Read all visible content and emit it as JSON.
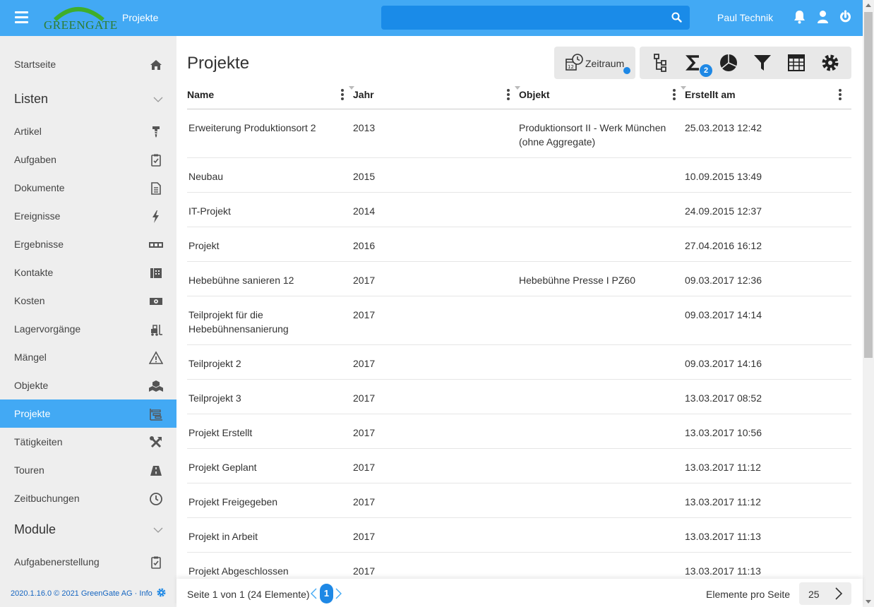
{
  "header": {
    "logo_text": "GREENGATE",
    "app_title": "Projekte",
    "search_placeholder": "",
    "user_name": "Paul Technik"
  },
  "sidebar": {
    "home": "Startseite",
    "group_listen": "Listen",
    "items": [
      "Artikel",
      "Aufgaben",
      "Dokumente",
      "Ereignisse",
      "Ergebnisse",
      "Kontakte",
      "Kosten",
      "Lagervorgänge",
      "Mängel",
      "Objekte",
      "Projekte",
      "Tätigkeiten",
      "Touren",
      "Zeitbuchungen"
    ],
    "group_module": "Module",
    "module_items": [
      "Aufgabenerstellung"
    ],
    "footer_text": "2020.1.16.0 © 2021 GreenGate AG · Info"
  },
  "main": {
    "title": "Projekte",
    "zeitraum_label": "Zeitraum",
    "sum_badge": "2",
    "columns": [
      "Name",
      "Jahr",
      "Objekt",
      "Erstellt am"
    ],
    "rows": [
      [
        "Erweiterung Produktionsort 2",
        "2013",
        "Produktionsort II - Werk München (ohne Aggregate)",
        "25.03.2013 12:42"
      ],
      [
        "Neubau",
        "2015",
        "",
        "10.09.2015 13:49"
      ],
      [
        "IT-Projekt",
        "2014",
        "",
        "24.09.2015 12:37"
      ],
      [
        "Projekt",
        "2016",
        "",
        "27.04.2016 16:12"
      ],
      [
        "Hebebühne sanieren 12",
        "2017",
        "Hebebühne Presse I PZ60",
        "09.03.2017 12:36"
      ],
      [
        "Teilprojekt für die Hebebühnensanierung",
        "2017",
        "",
        "09.03.2017 14:14"
      ],
      [
        "Teilprojekt 2",
        "2017",
        "",
        "09.03.2017 14:16"
      ],
      [
        "Teilprojekt 3",
        "2017",
        "",
        "13.03.2017 08:52"
      ],
      [
        "Projekt Erstellt",
        "2017",
        "",
        "13.03.2017 10:56"
      ],
      [
        "Projekt Geplant",
        "2017",
        "",
        "13.03.2017 11:12"
      ],
      [
        "Projekt Freigegeben",
        "2017",
        "",
        "13.03.2017 11:12"
      ],
      [
        "Projekt in Arbeit",
        "2017",
        "",
        "13.03.2017 11:13"
      ],
      [
        "Projekt Abgeschlossen",
        "2017",
        "",
        "13.03.2017 11:13"
      ]
    ]
  },
  "pagination": {
    "summary": "Seite 1 von 1 (24 Elemente)",
    "current_page": "1",
    "per_page_label": "Elemente pro Seite",
    "per_page_value": "25"
  },
  "colors": {
    "accent": "#42a9f4",
    "search_bg": "#1a8be8",
    "badge": "#1e88e5",
    "sidebar_bg": "#eeeeee"
  }
}
